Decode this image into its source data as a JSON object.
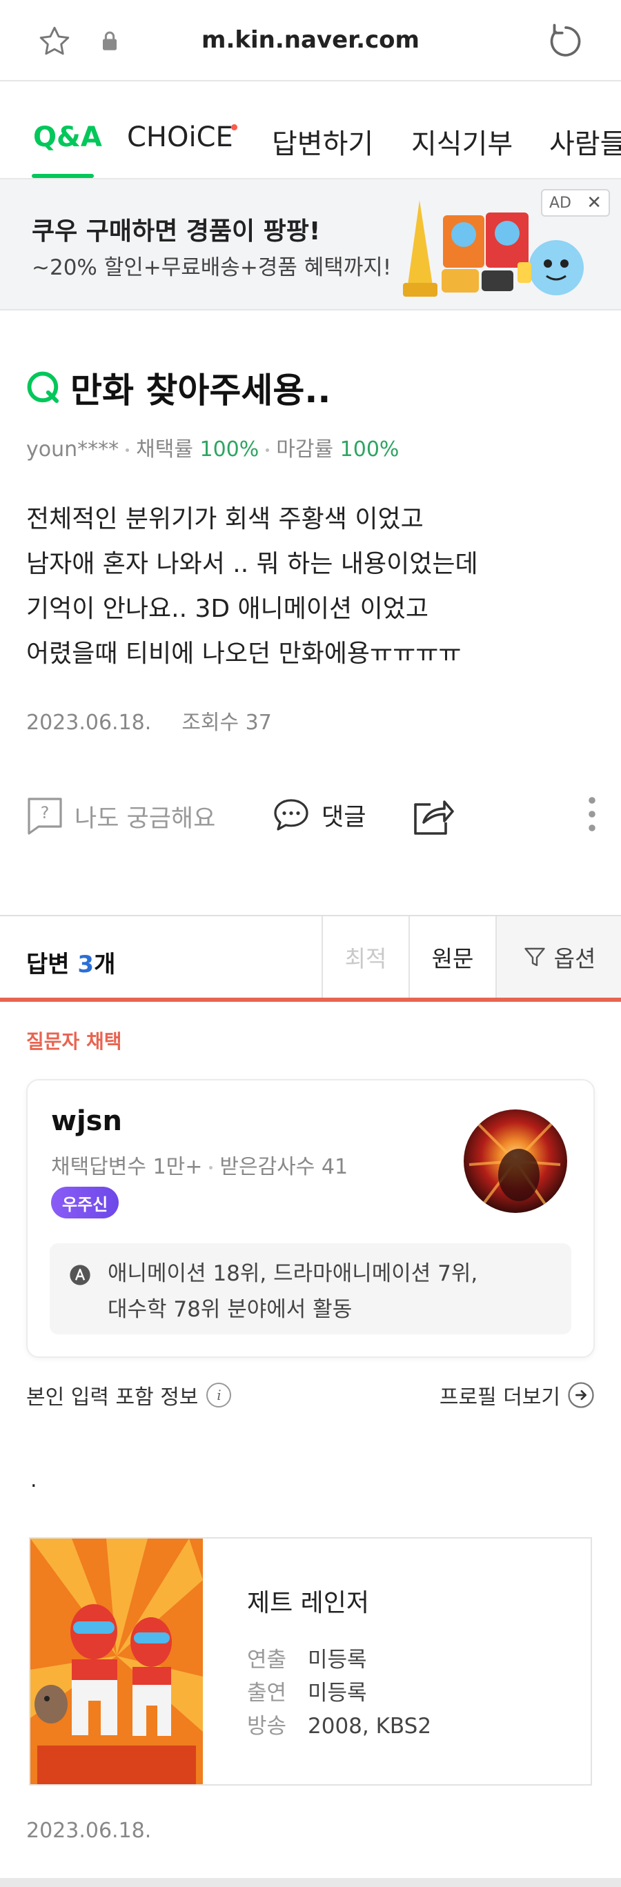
{
  "browser": {
    "url": "m.kin.naver.com"
  },
  "tabs": [
    {
      "label": "Q&A",
      "active": true
    },
    {
      "label": "CHOiCE",
      "dot": true
    },
    {
      "label": "답변하기"
    },
    {
      "label": "지식기부"
    },
    {
      "label": "사람들"
    }
  ],
  "ad": {
    "title": "쿠우 구매하면 경품이 팡팡!",
    "subtitle": "~20% 할인+무료배송+경품 혜택까지!",
    "badge": "AD"
  },
  "question": {
    "title": "만화 찾아주세용..",
    "author": "youn****",
    "adopt_label": "채택률",
    "adopt_rate": "100%",
    "close_label": "마감률",
    "close_rate": "100%",
    "body_lines": [
      "전체적인 분위기가 회색 주황색 이었고",
      "남자애 혼자 나와서 .. 뭐 하는 내용이었는데",
      "기억이 안나요.. 3D 애니메이션 이었고",
      "어렸을때 티비에 나오던 만화에용ㅠㅠㅠㅠ"
    ],
    "date": "2023.06.18.",
    "views": "조회수 37"
  },
  "actions": {
    "curious": "나도 궁금해요",
    "comment": "댓글"
  },
  "answers": {
    "label": "답변",
    "count": "3",
    "unit": "개",
    "sort_best": "최적",
    "sort_original": "원문",
    "options": "옵션"
  },
  "chosen": {
    "label": "질문자 채택",
    "profile": {
      "name": "wjsn",
      "stat1": "채택답변수 1만+",
      "stat2": "받은감사수 41",
      "badge": "우주신",
      "fields_line1": "애니메이션 18위, 드라마애니메이션 7위,",
      "fields_line2": "대수학 78위 분야에서 활동"
    },
    "info_label": "본인 입력 포함 정보",
    "more_profile": "프로필 더보기",
    "answer_text": "."
  },
  "media": {
    "title": "제트 레인저",
    "rows": [
      {
        "k": "연출",
        "v": "미등록"
      },
      {
        "k": "출연",
        "v": "미등록"
      },
      {
        "k": "방송",
        "v": "2008, KBS2"
      }
    ]
  },
  "answer_date": "2023.06.18.",
  "colors": {
    "naver_green": "#03c75a",
    "accent_red": "#e86451",
    "rate_green": "#2da562"
  }
}
